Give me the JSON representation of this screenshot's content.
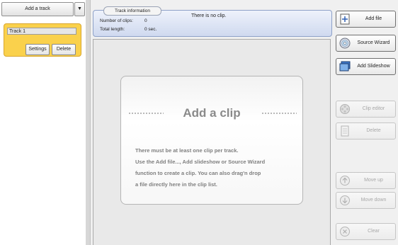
{
  "left_panel": {
    "add_track_label": "Add a track",
    "dropdown_glyph": "▼",
    "track": {
      "name": "Track 1",
      "settings_label": "Settings",
      "delete_label": "Delete"
    }
  },
  "track_info": {
    "tab_label": "Track information",
    "status": "There is no clip.",
    "clips_label": "Number of clips:",
    "clips_value": "0",
    "length_label": "Total length:",
    "length_value": "0 sec."
  },
  "clip_area": {
    "title": "Add a clip",
    "lines": [
      "There must be at least one clip per track.",
      "Use the Add file..., Add slideshow or Source Wizard",
      "function to create a  clip. You can also drag'n drop",
      "a file directly here in the clip list."
    ]
  },
  "buttons": {
    "add_file": "Add file",
    "source_wizard": "Source Wizard",
    "add_slideshow": "Add Slideshow",
    "clip_editor": "Clip editor",
    "delete": "Delete",
    "move_up": "Move up",
    "move_down": "Move down",
    "clear": "Clear"
  },
  "icons": {
    "add_file": "add-file-icon",
    "source_wizard": "disc-icon",
    "add_slideshow": "slideshow-icon",
    "clip_editor": "film-reel-icon",
    "delete": "delete-page-icon",
    "move_up": "arrow-up-icon",
    "move_down": "arrow-down-icon",
    "clear": "clear-x-icon"
  },
  "colors": {
    "track_card": "#fad14c",
    "info_panel": "#cfd9ef",
    "disabled_text": "#a8a8a8"
  }
}
